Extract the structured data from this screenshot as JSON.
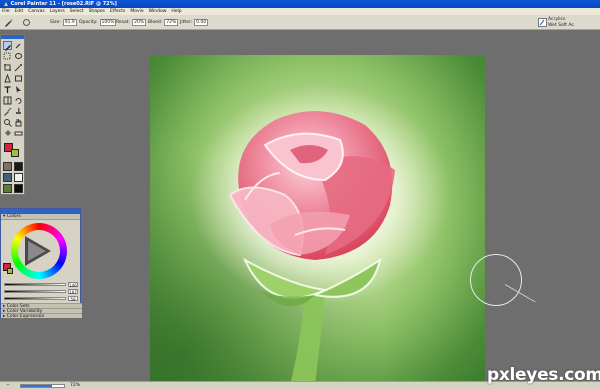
{
  "window": {
    "title": "Corel Painter 11 - [rose02.RIF @ 72%]"
  },
  "menu": {
    "items": [
      "File",
      "Edit",
      "Canvas",
      "Layers",
      "Select",
      "Shapes",
      "Effects",
      "Movie",
      "Window",
      "Help"
    ]
  },
  "property_bar": {
    "size_label": "Size:",
    "size_value": "91.9",
    "opacity_label": "Opacity:",
    "opacity_value": "100%",
    "resat_label": "Resat:",
    "resat_value": "20%",
    "bleed_label": "Bleed:",
    "bleed_value": "72%",
    "jitter_label": "Jitter:",
    "jitter_value": "0.00",
    "brush_category": "Acrylics",
    "brush_variant": "Wet Soft Ac"
  },
  "colors_panel": {
    "title": "Colors",
    "main_color": "#d8223a",
    "additional_color": "#9ac23b",
    "slider_values": [
      "146",
      "197",
      "59"
    ],
    "subpanels": [
      "Color Sets",
      "Color Variability",
      "Color Expression"
    ]
  },
  "status": {
    "zoom": "72%",
    "zoom_fraction": 0.72
  },
  "watermark": "pxleyes.com",
  "colors": {
    "titlebar": "#0a57d8",
    "menu_bg": "#ece9d8",
    "workspace": "#6e6e6e",
    "rose": "#e2607a",
    "stem": "#7ab64e"
  }
}
